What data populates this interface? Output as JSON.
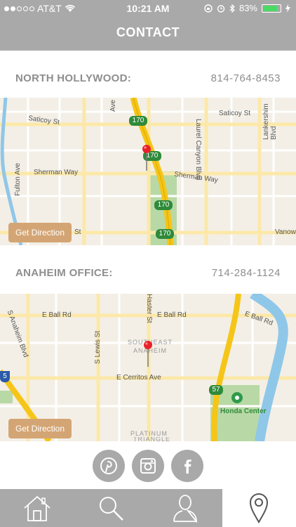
{
  "status_bar": {
    "carrier": "AT&T",
    "time": "10:21 AM",
    "battery": "83%"
  },
  "header": {
    "title": "CONTACT"
  },
  "offices": [
    {
      "name": "NORTH HOLLYWOOD:",
      "phone": "814-764-8453",
      "map_labels": {
        "saticoy_left": "Saticoy St",
        "saticoy_right": "Saticoy St",
        "sherman_left": "Sherman Way",
        "sherman_right": "Sherman Way",
        "vanowen": "Vanow",
        "fulton": "Fulton Ave",
        "lankershim": "Lankershim Blvd",
        "laurel": "Laurel Canyon Blvd",
        "ave": "Ave",
        "st_frag": "St",
        "hwy": "170"
      },
      "button": "Get Direction"
    },
    {
      "name": "ANAHEIM OFFICE:",
      "phone": "714-284-1124",
      "map_labels": {
        "ball_left": "E Ball Rd",
        "ball_mid": "E Ball Rd",
        "ball_right": "E Ball Rd",
        "cerritos": "E Cerritos Ave",
        "anaheim_blvd": "S Anaheim Blvd",
        "lewis": "S Lewis St",
        "haster": "Haster St",
        "southeast": "SOUTHEAST",
        "anaheim": "ANAHEIM",
        "platinum": "PLATINUM",
        "triangle": "TRIANGLE",
        "honda": "Honda Center",
        "hwy57": "57",
        "i5": "5"
      },
      "button": "Get Direction"
    }
  ],
  "social": [
    "pinterest-icon",
    "instagram-icon",
    "facebook-icon"
  ],
  "tabs": [
    "home-icon",
    "search-icon",
    "profile-icon",
    "location-pin-icon"
  ],
  "colors": {
    "header": "#a9a9aa",
    "button": "#d4a574",
    "pin": "#e8222a",
    "highway": "#f5c518",
    "water": "#8fc7e8",
    "park": "#b8d9a6"
  }
}
